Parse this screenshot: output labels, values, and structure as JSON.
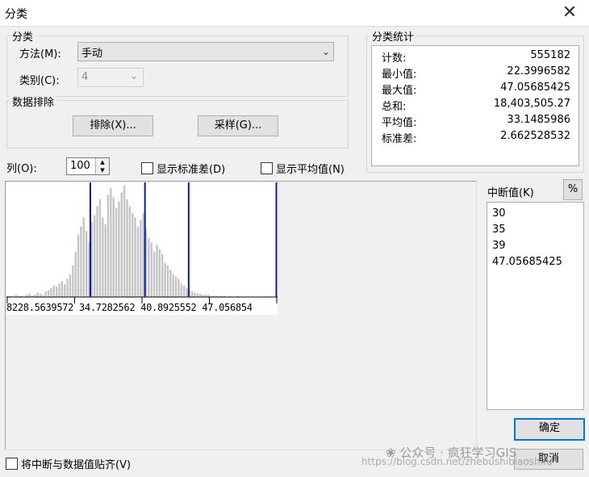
{
  "window": {
    "title": "分类",
    "close_glyph": "✕"
  },
  "classification": {
    "group_label": "分类",
    "method_label": "方法(M):",
    "method_value": "手动",
    "classes_label": "类别(C):",
    "classes_value": "4"
  },
  "exclusion": {
    "group_label": "数据排除",
    "exclude_button": "排除(X)...",
    "sample_button": "采样(G)..."
  },
  "statistics": {
    "group_label": "分类统计",
    "rows": [
      {
        "label": "计数:",
        "value": "555182"
      },
      {
        "label": "最小值:",
        "value": "22.3996582"
      },
      {
        "label": "最大值:",
        "value": "47.05685425"
      },
      {
        "label": "总和:",
        "value": "18,403,505.27"
      },
      {
        "label": "平均值:",
        "value": "33.1485986"
      },
      {
        "label": "标准差:",
        "value": "2.662528532"
      }
    ]
  },
  "histogram_options": {
    "columns_label": "列(O):",
    "columns_value": "100",
    "show_std_label": "显示标准差(D)",
    "show_mean_label": "显示平均值(N)"
  },
  "histogram": {
    "axis_labels_text": "8228.5639572 34.7282562 40.8925552 47.056854",
    "bars": [
      1,
      1,
      0,
      2,
      1,
      1,
      0,
      2,
      3,
      1,
      2,
      4,
      3,
      2,
      5,
      6,
      8,
      10,
      9,
      12,
      14,
      11,
      16,
      20,
      28,
      40,
      55,
      62,
      70,
      58,
      48,
      66,
      72,
      80,
      86,
      70,
      64,
      90,
      96,
      88,
      78,
      84,
      92,
      98,
      86,
      80,
      74,
      70,
      62,
      68,
      74,
      60,
      52,
      48,
      40,
      46,
      42,
      38,
      30,
      28,
      24,
      20,
      18,
      16,
      12,
      10,
      8,
      6,
      5,
      4,
      3,
      3,
      2,
      2,
      2,
      1,
      1,
      1,
      1,
      1,
      1,
      0,
      1,
      0,
      0,
      1,
      0,
      0,
      0,
      0,
      0,
      0,
      0,
      0,
      0,
      0,
      0,
      0,
      0,
      0
    ],
    "min": 22.3996582,
    "max": 47.05685425,
    "breaks": [
      30,
      35,
      39,
      47.05685425
    ],
    "bar_color": "#c4c4c4",
    "break_color": "#0a1aa8"
  },
  "break_values": {
    "label": "中断值(K)",
    "percent_button": "%",
    "items": [
      "30",
      "35",
      "39",
      "47.05685425"
    ]
  },
  "snap": {
    "label": "将中断与数据值贴齐(V)"
  },
  "buttons": {
    "ok": "确定",
    "cancel": "取消"
  },
  "watermark": {
    "line1": "公众号 · 疯狂学习GIS",
    "line2": "https://blog.csdn.net/zhebushibiaoshifu"
  }
}
